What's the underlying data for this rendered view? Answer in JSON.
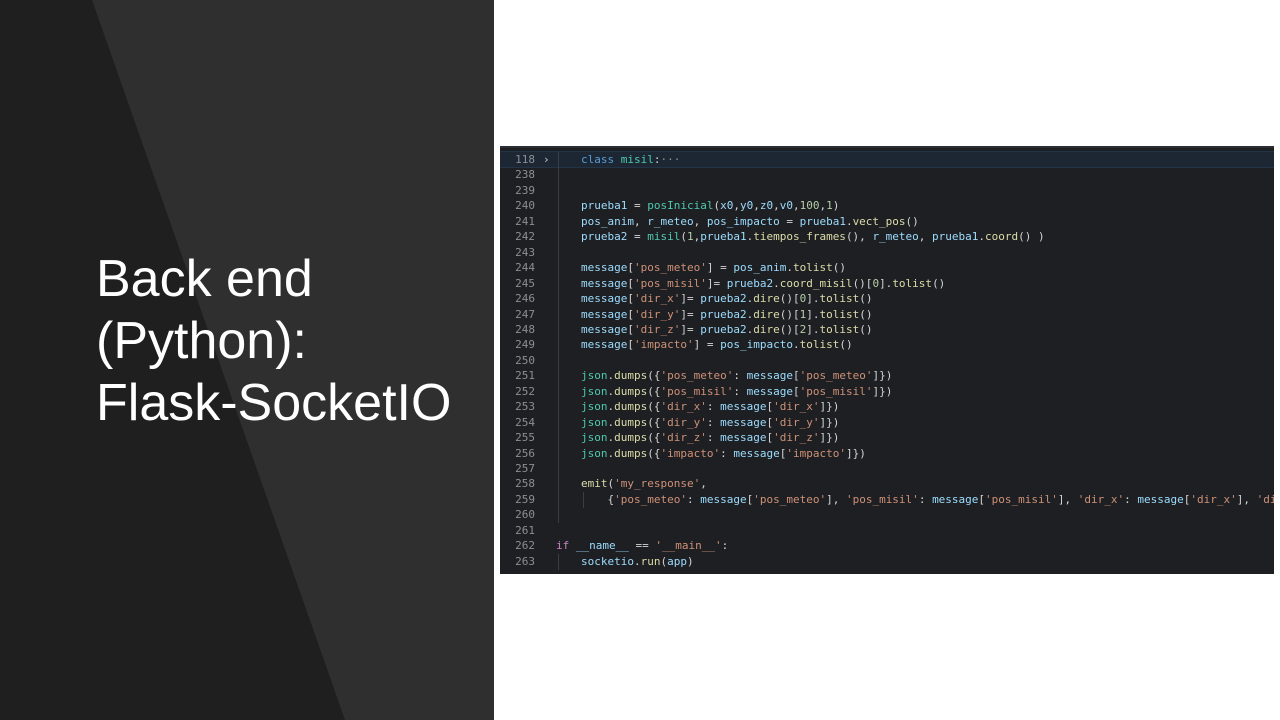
{
  "slide": {
    "title_lines": [
      "Back end",
      "(Python):",
      "Flask-SocketIO"
    ]
  },
  "colors": {
    "left_panel": "#2f2f2f",
    "left_panel_shape": "#1f1f1f",
    "editor_bg": "#1e1f22",
    "keyword": "#c586c0",
    "function": "#dcdcaa",
    "variable": "#9cdcfe",
    "class": "#4ec9b0",
    "string": "#ce9178",
    "number": "#b5cea8"
  },
  "editor": {
    "lines": [
      {
        "n": "118",
        "fold": "›",
        "tokens": [
          [
            "kw2",
            "class "
          ],
          [
            "cls",
            "misil"
          ],
          [
            "pl",
            ":"
          ],
          [
            "ell",
            "···"
          ]
        ],
        "indent": 1,
        "active": true
      },
      {
        "n": "238",
        "tokens": [],
        "indent": 1
      },
      {
        "n": "239",
        "tokens": [],
        "indent": 1
      },
      {
        "n": "240",
        "tokens": [
          [
            "var",
            "prueba1"
          ],
          [
            "op",
            " = "
          ],
          [
            "cls",
            "posInicial"
          ],
          [
            "pl",
            "("
          ],
          [
            "var",
            "x0"
          ],
          [
            "pl",
            ","
          ],
          [
            "var",
            "y0"
          ],
          [
            "pl",
            ","
          ],
          [
            "var",
            "z0"
          ],
          [
            "pl",
            ","
          ],
          [
            "var",
            "v0"
          ],
          [
            "pl",
            ","
          ],
          [
            "num",
            "100"
          ],
          [
            "pl",
            ","
          ],
          [
            "num",
            "1"
          ],
          [
            "pl",
            ")"
          ]
        ],
        "indent": 1
      },
      {
        "n": "241",
        "tokens": [
          [
            "var",
            "pos_anim"
          ],
          [
            "pl",
            ", "
          ],
          [
            "var",
            "r_meteo"
          ],
          [
            "pl",
            ", "
          ],
          [
            "var",
            "pos_impacto"
          ],
          [
            "op",
            " = "
          ],
          [
            "var",
            "prueba1"
          ],
          [
            "pl",
            "."
          ],
          [
            "fn",
            "vect_pos"
          ],
          [
            "pl",
            "()"
          ]
        ],
        "indent": 1
      },
      {
        "n": "242",
        "tokens": [
          [
            "var",
            "prueba2"
          ],
          [
            "op",
            " = "
          ],
          [
            "cls",
            "misil"
          ],
          [
            "pl",
            "("
          ],
          [
            "num",
            "1"
          ],
          [
            "pl",
            ","
          ],
          [
            "var",
            "prueba1"
          ],
          [
            "pl",
            "."
          ],
          [
            "fn",
            "tiempos_frames"
          ],
          [
            "pl",
            "(), "
          ],
          [
            "var",
            "r_meteo"
          ],
          [
            "pl",
            ", "
          ],
          [
            "var",
            "prueba1"
          ],
          [
            "pl",
            "."
          ],
          [
            "fn",
            "coord"
          ],
          [
            "pl",
            "() )"
          ]
        ],
        "indent": 1
      },
      {
        "n": "243",
        "tokens": [],
        "indent": 1
      },
      {
        "n": "244",
        "tokens": [
          [
            "var",
            "message"
          ],
          [
            "pl",
            "["
          ],
          [
            "str",
            "'pos_meteo'"
          ],
          [
            "pl",
            "]"
          ],
          [
            "op",
            " = "
          ],
          [
            "var",
            "pos_anim"
          ],
          [
            "pl",
            "."
          ],
          [
            "fn",
            "tolist"
          ],
          [
            "pl",
            "()"
          ]
        ],
        "indent": 1
      },
      {
        "n": "245",
        "tokens": [
          [
            "var",
            "message"
          ],
          [
            "pl",
            "["
          ],
          [
            "str",
            "'pos_misil'"
          ],
          [
            "pl",
            "]"
          ],
          [
            "op",
            "= "
          ],
          [
            "var",
            "prueba2"
          ],
          [
            "pl",
            "."
          ],
          [
            "fn",
            "coord_misil"
          ],
          [
            "pl",
            "()["
          ],
          [
            "num",
            "0"
          ],
          [
            "pl",
            "]."
          ],
          [
            "fn",
            "tolist"
          ],
          [
            "pl",
            "()"
          ]
        ],
        "indent": 1
      },
      {
        "n": "246",
        "tokens": [
          [
            "var",
            "message"
          ],
          [
            "pl",
            "["
          ],
          [
            "str",
            "'dir_x'"
          ],
          [
            "pl",
            "]"
          ],
          [
            "op",
            "= "
          ],
          [
            "var",
            "prueba2"
          ],
          [
            "pl",
            "."
          ],
          [
            "fn",
            "dire"
          ],
          [
            "pl",
            "()["
          ],
          [
            "num",
            "0"
          ],
          [
            "pl",
            "]."
          ],
          [
            "fn",
            "tolist"
          ],
          [
            "pl",
            "()"
          ]
        ],
        "indent": 1
      },
      {
        "n": "247",
        "tokens": [
          [
            "var",
            "message"
          ],
          [
            "pl",
            "["
          ],
          [
            "str",
            "'dir_y'"
          ],
          [
            "pl",
            "]"
          ],
          [
            "op",
            "= "
          ],
          [
            "var",
            "prueba2"
          ],
          [
            "pl",
            "."
          ],
          [
            "fn",
            "dire"
          ],
          [
            "pl",
            "()["
          ],
          [
            "num",
            "1"
          ],
          [
            "pl",
            "]."
          ],
          [
            "fn",
            "tolist"
          ],
          [
            "pl",
            "()"
          ]
        ],
        "indent": 1
      },
      {
        "n": "248",
        "tokens": [
          [
            "var",
            "message"
          ],
          [
            "pl",
            "["
          ],
          [
            "str",
            "'dir_z'"
          ],
          [
            "pl",
            "]"
          ],
          [
            "op",
            "= "
          ],
          [
            "var",
            "prueba2"
          ],
          [
            "pl",
            "."
          ],
          [
            "fn",
            "dire"
          ],
          [
            "pl",
            "()["
          ],
          [
            "num",
            "2"
          ],
          [
            "pl",
            "]."
          ],
          [
            "fn",
            "tolist"
          ],
          [
            "pl",
            "()"
          ]
        ],
        "indent": 1
      },
      {
        "n": "249",
        "tokens": [
          [
            "var",
            "message"
          ],
          [
            "pl",
            "["
          ],
          [
            "str",
            "'impacto'"
          ],
          [
            "pl",
            "]"
          ],
          [
            "op",
            " = "
          ],
          [
            "var",
            "pos_impacto"
          ],
          [
            "pl",
            "."
          ],
          [
            "fn",
            "tolist"
          ],
          [
            "pl",
            "()"
          ]
        ],
        "indent": 1
      },
      {
        "n": "250",
        "tokens": [],
        "indent": 1
      },
      {
        "n": "251",
        "tokens": [
          [
            "cls",
            "json"
          ],
          [
            "pl",
            "."
          ],
          [
            "fn",
            "dumps"
          ],
          [
            "pl",
            "({"
          ],
          [
            "str",
            "'pos_meteo'"
          ],
          [
            "pl",
            ": "
          ],
          [
            "var",
            "message"
          ],
          [
            "pl",
            "["
          ],
          [
            "str",
            "'pos_meteo'"
          ],
          [
            "pl",
            "]})"
          ]
        ],
        "indent": 1
      },
      {
        "n": "252",
        "tokens": [
          [
            "cls",
            "json"
          ],
          [
            "pl",
            "."
          ],
          [
            "fn",
            "dumps"
          ],
          [
            "pl",
            "({"
          ],
          [
            "str",
            "'pos_misil'"
          ],
          [
            "pl",
            ": "
          ],
          [
            "var",
            "message"
          ],
          [
            "pl",
            "["
          ],
          [
            "str",
            "'pos_misil'"
          ],
          [
            "pl",
            "]})"
          ]
        ],
        "indent": 1
      },
      {
        "n": "253",
        "tokens": [
          [
            "cls",
            "json"
          ],
          [
            "pl",
            "."
          ],
          [
            "fn",
            "dumps"
          ],
          [
            "pl",
            "({"
          ],
          [
            "str",
            "'dir_x'"
          ],
          [
            "pl",
            ": "
          ],
          [
            "var",
            "message"
          ],
          [
            "pl",
            "["
          ],
          [
            "str",
            "'dir_x'"
          ],
          [
            "pl",
            "]})"
          ]
        ],
        "indent": 1
      },
      {
        "n": "254",
        "tokens": [
          [
            "cls",
            "json"
          ],
          [
            "pl",
            "."
          ],
          [
            "fn",
            "dumps"
          ],
          [
            "pl",
            "({"
          ],
          [
            "str",
            "'dir_y'"
          ],
          [
            "pl",
            ": "
          ],
          [
            "var",
            "message"
          ],
          [
            "pl",
            "["
          ],
          [
            "str",
            "'dir_y'"
          ],
          [
            "pl",
            "]})"
          ]
        ],
        "indent": 1
      },
      {
        "n": "255",
        "tokens": [
          [
            "cls",
            "json"
          ],
          [
            "pl",
            "."
          ],
          [
            "fn",
            "dumps"
          ],
          [
            "pl",
            "({"
          ],
          [
            "str",
            "'dir_z'"
          ],
          [
            "pl",
            ": "
          ],
          [
            "var",
            "message"
          ],
          [
            "pl",
            "["
          ],
          [
            "str",
            "'dir_z'"
          ],
          [
            "pl",
            "]})"
          ]
        ],
        "indent": 1
      },
      {
        "n": "256",
        "tokens": [
          [
            "cls",
            "json"
          ],
          [
            "pl",
            "."
          ],
          [
            "fn",
            "dumps"
          ],
          [
            "pl",
            "({"
          ],
          [
            "str",
            "'impacto'"
          ],
          [
            "pl",
            ": "
          ],
          [
            "var",
            "message"
          ],
          [
            "pl",
            "["
          ],
          [
            "str",
            "'impacto'"
          ],
          [
            "pl",
            "]})"
          ]
        ],
        "indent": 1
      },
      {
        "n": "257",
        "tokens": [],
        "indent": 1
      },
      {
        "n": "258",
        "tokens": [
          [
            "fn",
            "emit"
          ],
          [
            "pl",
            "("
          ],
          [
            "str",
            "'my_response'"
          ],
          [
            "pl",
            ","
          ]
        ],
        "indent": 1
      },
      {
        "n": "259",
        "tokens": [
          [
            "pl",
            "    {"
          ],
          [
            "str",
            "'pos_meteo'"
          ],
          [
            "pl",
            ": "
          ],
          [
            "var",
            "message"
          ],
          [
            "pl",
            "["
          ],
          [
            "str",
            "'pos_meteo'"
          ],
          [
            "pl",
            "], "
          ],
          [
            "str",
            "'pos_misil'"
          ],
          [
            "pl",
            ": "
          ],
          [
            "var",
            "message"
          ],
          [
            "pl",
            "["
          ],
          [
            "str",
            "'pos_misil'"
          ],
          [
            "pl",
            "], "
          ],
          [
            "str",
            "'dir_x'"
          ],
          [
            "pl",
            ": "
          ],
          [
            "var",
            "message"
          ],
          [
            "pl",
            "["
          ],
          [
            "str",
            "'dir_x'"
          ],
          [
            "pl",
            "], "
          ],
          [
            "str",
            "'dir_y'"
          ],
          [
            "pl",
            ":"
          ]
        ],
        "indent": 2
      },
      {
        "n": "260",
        "tokens": [],
        "indent": 1
      },
      {
        "n": "261",
        "tokens": [],
        "indent": 0
      },
      {
        "n": "262",
        "tokens": [
          [
            "kw",
            "if"
          ],
          [
            "pl",
            " "
          ],
          [
            "var",
            "__name__"
          ],
          [
            "op",
            " == "
          ],
          [
            "str",
            "'__main__'"
          ],
          [
            "pl",
            ":"
          ]
        ],
        "indent": 0,
        "code_offset": 0
      },
      {
        "n": "263",
        "tokens": [
          [
            "var",
            "socketio"
          ],
          [
            "pl",
            "."
          ],
          [
            "fn",
            "run"
          ],
          [
            "pl",
            "("
          ],
          [
            "var",
            "app"
          ],
          [
            "pl",
            ")"
          ]
        ],
        "indent": 1
      }
    ]
  }
}
